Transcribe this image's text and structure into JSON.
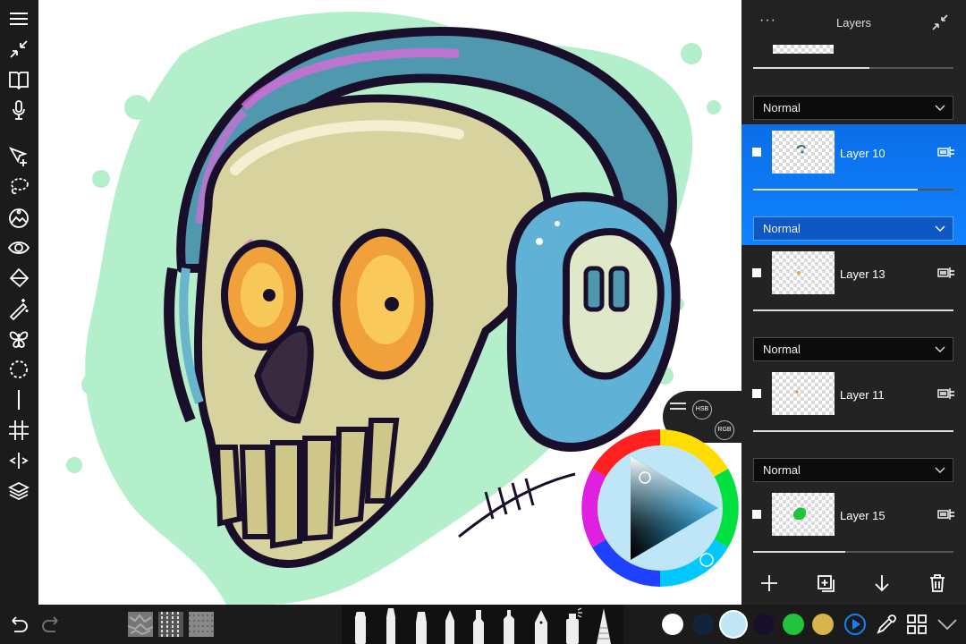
{
  "panel": {
    "title": "Layers",
    "more_label": "···"
  },
  "layers": [
    {
      "name": "Layer 10",
      "blend": "Normal",
      "selected": true,
      "opacity": 0.82
    },
    {
      "name": "Layer 13",
      "blend": "Normal",
      "selected": false,
      "opacity": 1.0
    },
    {
      "name": "Layer 11",
      "blend": "Normal",
      "selected": false,
      "opacity": 1.0
    },
    {
      "name": "Layer 15",
      "blend": "Normal",
      "selected": false,
      "opacity": 0.46
    }
  ],
  "top_layer": {
    "blend": "Normal",
    "opacity": 0.58
  },
  "color_modes": {
    "hsb": "HSB",
    "rgb": "RGB"
  },
  "swatches": [
    "#ffffff",
    "#10243a",
    "#bfe6f7",
    "#1a0f2a",
    "#1fc43a",
    "#d8b34a"
  ],
  "colors": {
    "accent": "#1182ff",
    "panel": "#232323",
    "toolbar": "#1b1b1b"
  }
}
